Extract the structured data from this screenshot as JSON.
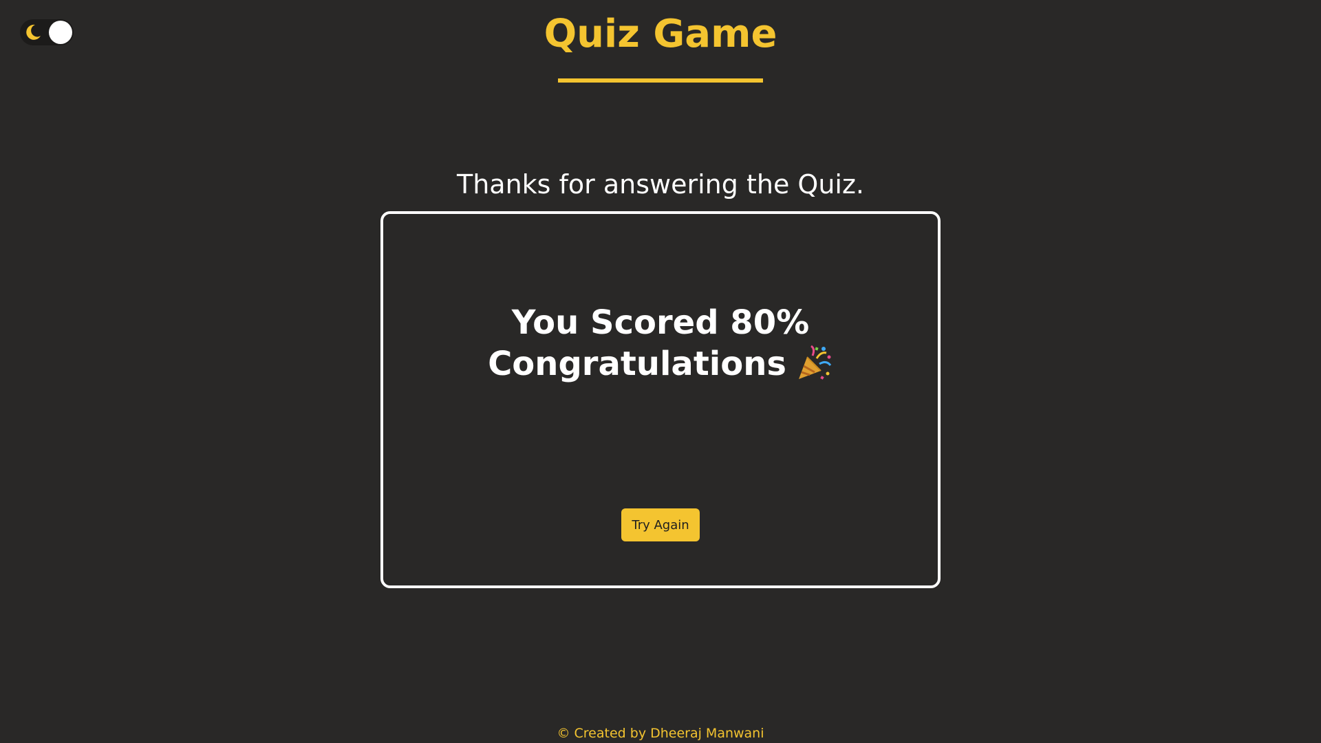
{
  "header": {
    "title": "Quiz Game"
  },
  "theme_toggle": {
    "icon": "moon-icon",
    "state": "dark"
  },
  "result": {
    "thanks_message": "Thanks for answering the Quiz.",
    "score_text": "You Scored 80%",
    "congrats_text": "Congratulations",
    "congrats_icon": "party-popper-icon",
    "try_again_label": "Try Again"
  },
  "footer": {
    "credit": "© Created by Dheeraj Manwani"
  },
  "colors": {
    "background": "#292827",
    "accent": "#f4c430",
    "text": "#ffffff"
  }
}
